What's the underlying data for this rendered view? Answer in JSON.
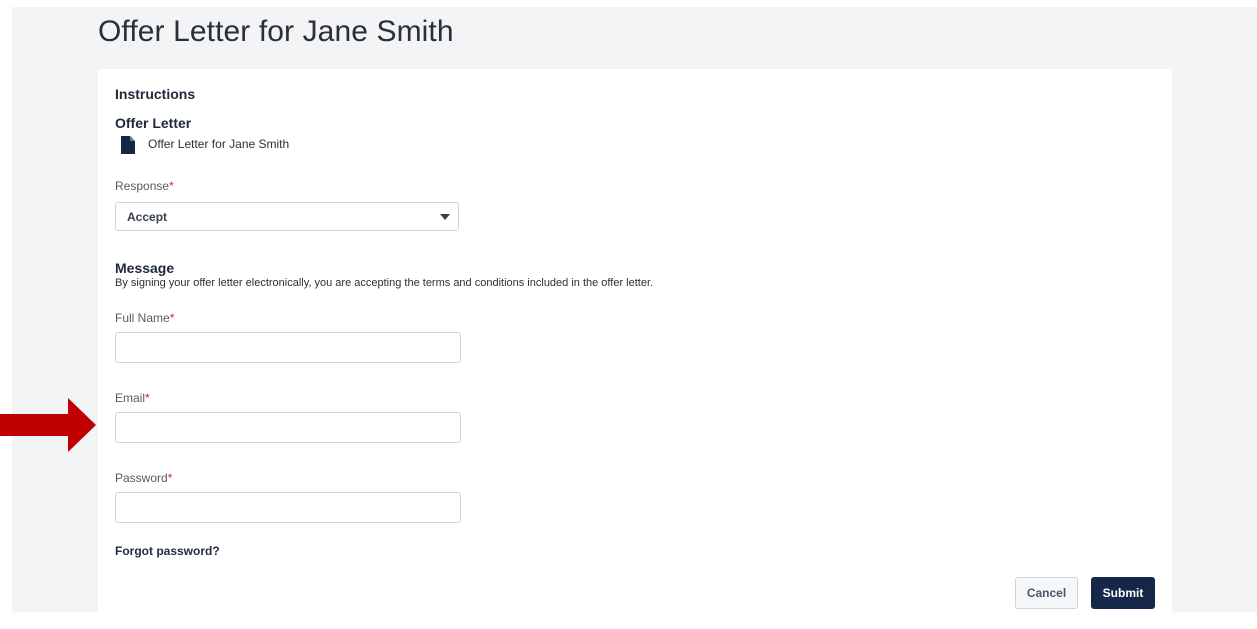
{
  "page": {
    "title": "Offer Letter for Jane Smith"
  },
  "instructions": {
    "heading": "Instructions",
    "offer_letter_heading": "Offer Letter",
    "document_icon": "document-icon",
    "document_link": "Offer Letter for Jane Smith"
  },
  "response": {
    "label": "Response",
    "required_mark": "*",
    "selected_value": "Accept"
  },
  "message": {
    "heading": "Message",
    "body": "By signing your offer letter electronically, you are accepting the terms and conditions included in the offer letter."
  },
  "fields": {
    "full_name": {
      "label": "Full Name",
      "required_mark": "*",
      "value": ""
    },
    "email": {
      "label": "Email",
      "required_mark": "*",
      "value": ""
    },
    "password": {
      "label": "Password",
      "required_mark": "*",
      "value": ""
    }
  },
  "links": {
    "forgot_password": "Forgot password?"
  },
  "buttons": {
    "cancel": "Cancel",
    "submit": "Submit"
  },
  "colors": {
    "primary": "#16274a",
    "required": "#c62828",
    "annotation_arrow": "#c00000",
    "page_background": "#f3f4f6"
  },
  "annotation": {
    "arrow_icon": "right-arrow-icon"
  }
}
